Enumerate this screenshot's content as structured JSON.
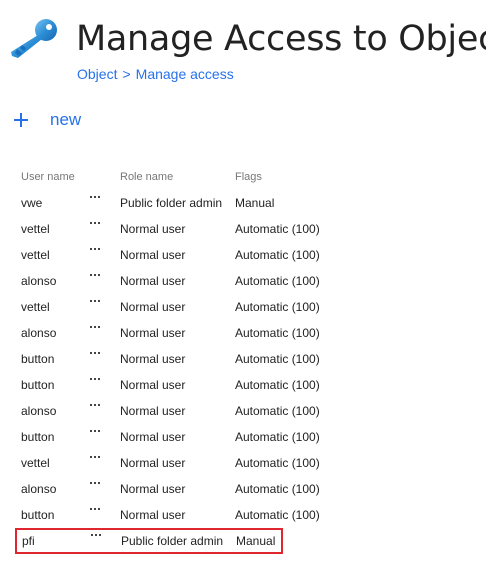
{
  "header": {
    "title": "Manage Access to Object",
    "icon": "key-icon",
    "breadcrumb": {
      "items": [
        "Object",
        "Manage access"
      ],
      "separator": ">"
    }
  },
  "toolbar": {
    "new_label": "new",
    "new_icon": "plus-icon"
  },
  "table": {
    "columns": {
      "user": "User name",
      "role": "Role name",
      "flags": "Flags"
    },
    "rows": [
      {
        "user": "vwe",
        "role": "Public folder admin",
        "flags": "Manual"
      },
      {
        "user": "vettel",
        "role": "Normal user",
        "flags": "Automatic (100)"
      },
      {
        "user": "vettel",
        "role": "Normal user",
        "flags": "Automatic (100)"
      },
      {
        "user": "alonso",
        "role": "Normal user",
        "flags": "Automatic (100)"
      },
      {
        "user": "vettel",
        "role": "Normal user",
        "flags": "Automatic (100)"
      },
      {
        "user": "alonso",
        "role": "Normal user",
        "flags": "Automatic (100)"
      },
      {
        "user": "button",
        "role": "Normal user",
        "flags": "Automatic (100)"
      },
      {
        "user": "button",
        "role": "Normal user",
        "flags": "Automatic (100)"
      },
      {
        "user": "alonso",
        "role": "Normal user",
        "flags": "Automatic (100)"
      },
      {
        "user": "button",
        "role": "Normal user",
        "flags": "Automatic (100)"
      },
      {
        "user": "vettel",
        "role": "Normal user",
        "flags": "Automatic (100)"
      },
      {
        "user": "alonso",
        "role": "Normal user",
        "flags": "Automatic (100)"
      },
      {
        "user": "button",
        "role": "Normal user",
        "flags": "Automatic (100)"
      },
      {
        "user": "pfi",
        "role": "Public folder admin",
        "flags": "Manual"
      }
    ],
    "highlighted_row_index": 13
  },
  "colors": {
    "accent": "#2672ec",
    "highlight_border": "#e0262e",
    "header_text": "#777777",
    "icon_blue": "#2c8fd6"
  }
}
